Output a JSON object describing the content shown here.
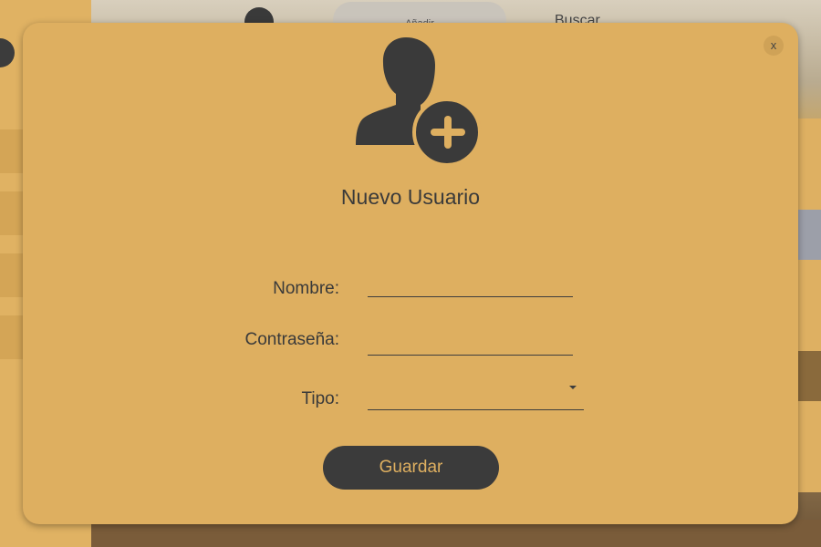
{
  "background": {
    "tab_add_label": "Añadir",
    "tab_search_label": "Buscar"
  },
  "modal": {
    "close_label": "x",
    "icon": "add-user-icon",
    "title": "Nuevo Usuario",
    "fields": {
      "name": {
        "label": "Nombre:",
        "value": ""
      },
      "password": {
        "label": "Contraseña:",
        "value": ""
      },
      "type": {
        "label": "Tipo:",
        "value": ""
      }
    },
    "save_label": "Guardar"
  },
  "colors": {
    "accent": "#deaf60",
    "dark": "#3b3b3b"
  }
}
